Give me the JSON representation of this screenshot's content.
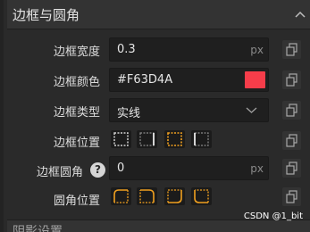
{
  "section": {
    "title": "边框与圆角",
    "next_title": "阴影设置"
  },
  "rows": {
    "width": {
      "label": "边框宽度",
      "value": "0.3",
      "unit": "px"
    },
    "color": {
      "label": "边框颜色",
      "value": "#F63D4A",
      "swatch": "#F63D4A"
    },
    "type": {
      "label": "边框类型",
      "value": "实线"
    },
    "position": {
      "label": "边框位置"
    },
    "radius": {
      "label": "边框圆角",
      "help": "?",
      "value": "0",
      "unit": "px"
    },
    "corner": {
      "label": "圆角位置"
    }
  },
  "colors": {
    "accent": "#F0A020",
    "inactive": "#d0d0d0"
  },
  "icons": {
    "header": "chevron-up-icon",
    "copy": "copy-icon",
    "select": "chevron-down-icon",
    "help": "help-icon"
  },
  "watermark": "CSDN @1_bit"
}
